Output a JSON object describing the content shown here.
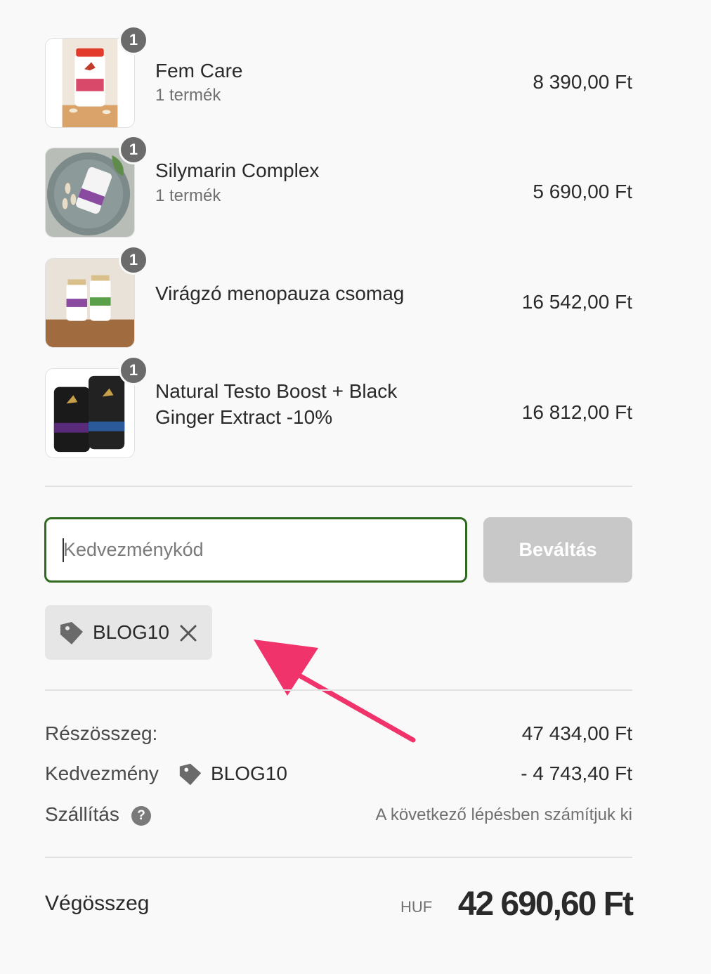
{
  "line_items": [
    {
      "name": "Fem Care",
      "quantity_label": "1 termék",
      "badge": "1",
      "price": "8 390,00 Ft"
    },
    {
      "name": "Silymarin Complex",
      "quantity_label": "1 termék",
      "badge": "1",
      "price": "5 690,00 Ft"
    },
    {
      "name": "Virágzó menopauza csomag",
      "quantity_label": "",
      "badge": "1",
      "price": "16 542,00 Ft"
    },
    {
      "name": "Natural Testo Boost + Black Ginger Extract -10%",
      "quantity_label": "",
      "badge": "1",
      "price": "16 812,00 Ft"
    }
  ],
  "discount": {
    "placeholder": "Kedvezménykód",
    "apply_label": "Beváltás",
    "applied_code": "BLOG10"
  },
  "summary": {
    "subtotal_label": "Részösszeg:",
    "subtotal_value": "47 434,00 Ft",
    "discount_label": "Kedvezmény",
    "discount_code": "BLOG10",
    "discount_value": "- 4 743,40 Ft",
    "shipping_label": "Szállítás",
    "shipping_help": "?",
    "shipping_value": "A következő lépésben számítjuk ki",
    "total_label": "Végösszeg",
    "currency": "HUF",
    "total_value": "42 690,60 Ft"
  },
  "colors": {
    "input_focus_border": "#2e6b1f",
    "apply_button_disabled": "#c8c8c8",
    "annotation_arrow": "#f0336a"
  }
}
